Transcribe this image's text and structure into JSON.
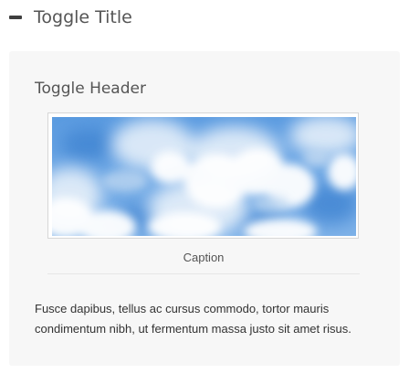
{
  "toggle": {
    "icon": "minus-icon",
    "title": "Toggle Title",
    "expanded": true
  },
  "panel": {
    "header": "Toggle Header",
    "image": {
      "description_icon": "cloud-sky-image"
    },
    "caption": "Caption",
    "text": "Fusce dapibus, tellus ac cursus commodo, tortor mauris condimentum nibh, ut fermentum massa justo sit amet risus."
  },
  "colors": {
    "panel_background": "#f7f7f7",
    "text": "#555555",
    "sky_blue": "#4d8fd6"
  }
}
